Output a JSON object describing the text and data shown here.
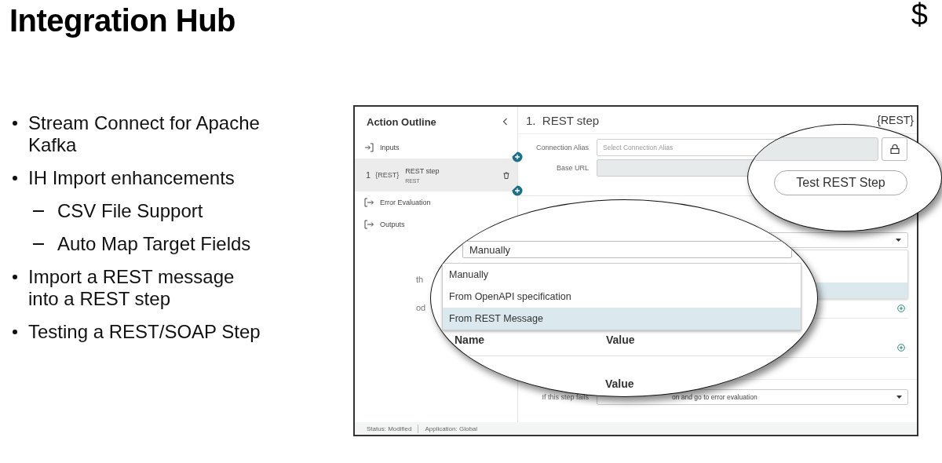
{
  "slide": {
    "title": "Integration Hub",
    "corner_symbol": "$"
  },
  "bullets": [
    {
      "lines": [
        "Stream Connect for Apache",
        "Kafka"
      ]
    },
    {
      "lines": [
        "IH Import enhancements"
      ],
      "children": [
        {
          "lines": [
            "CSV File Support"
          ]
        },
        {
          "lines": [
            "Auto Map Target Fields"
          ]
        }
      ]
    },
    {
      "lines": [
        "Import a REST message",
        "into a REST step"
      ]
    },
    {
      "lines": [
        "Testing a REST/SOAP Step"
      ]
    }
  ],
  "screen": {
    "outline": {
      "title": "Action Outline",
      "items": [
        {
          "kind": "input",
          "label": "Inputs",
          "selected": false
        },
        {
          "kind": "step",
          "number": "1",
          "badge": "{REST}",
          "label": "REST step",
          "sublabel": "REST",
          "selected": true
        },
        {
          "kind": "output",
          "label": "Error Evaluation",
          "selected": false
        },
        {
          "kind": "output",
          "label": "Outputs",
          "selected": false
        }
      ]
    },
    "step": {
      "number": "1.",
      "title": "REST step",
      "badge": "{REST}",
      "connection_label": "Connection Alias",
      "connection_placeholder": "Select Connection Alias",
      "base_url_label": "Base URL",
      "hidden_labels": [
        "th",
        "od"
      ],
      "failure_label": "If this step fails",
      "failure_value": "on and go to error evaluation"
    },
    "test_zoom": {
      "button": "Test REST Step"
    },
    "import_zoom": {
      "value": "Manually",
      "options": [
        {
          "label": "Manually",
          "highlighted": false
        },
        {
          "label": "From OpenAPI specification",
          "highlighted": false
        },
        {
          "label": "From REST Message",
          "highlighted": true
        }
      ],
      "columns": [
        "Name",
        "Value"
      ],
      "extra_column": "Value"
    },
    "status_bar": [
      "Status: Modified",
      "Application: Global"
    ]
  }
}
